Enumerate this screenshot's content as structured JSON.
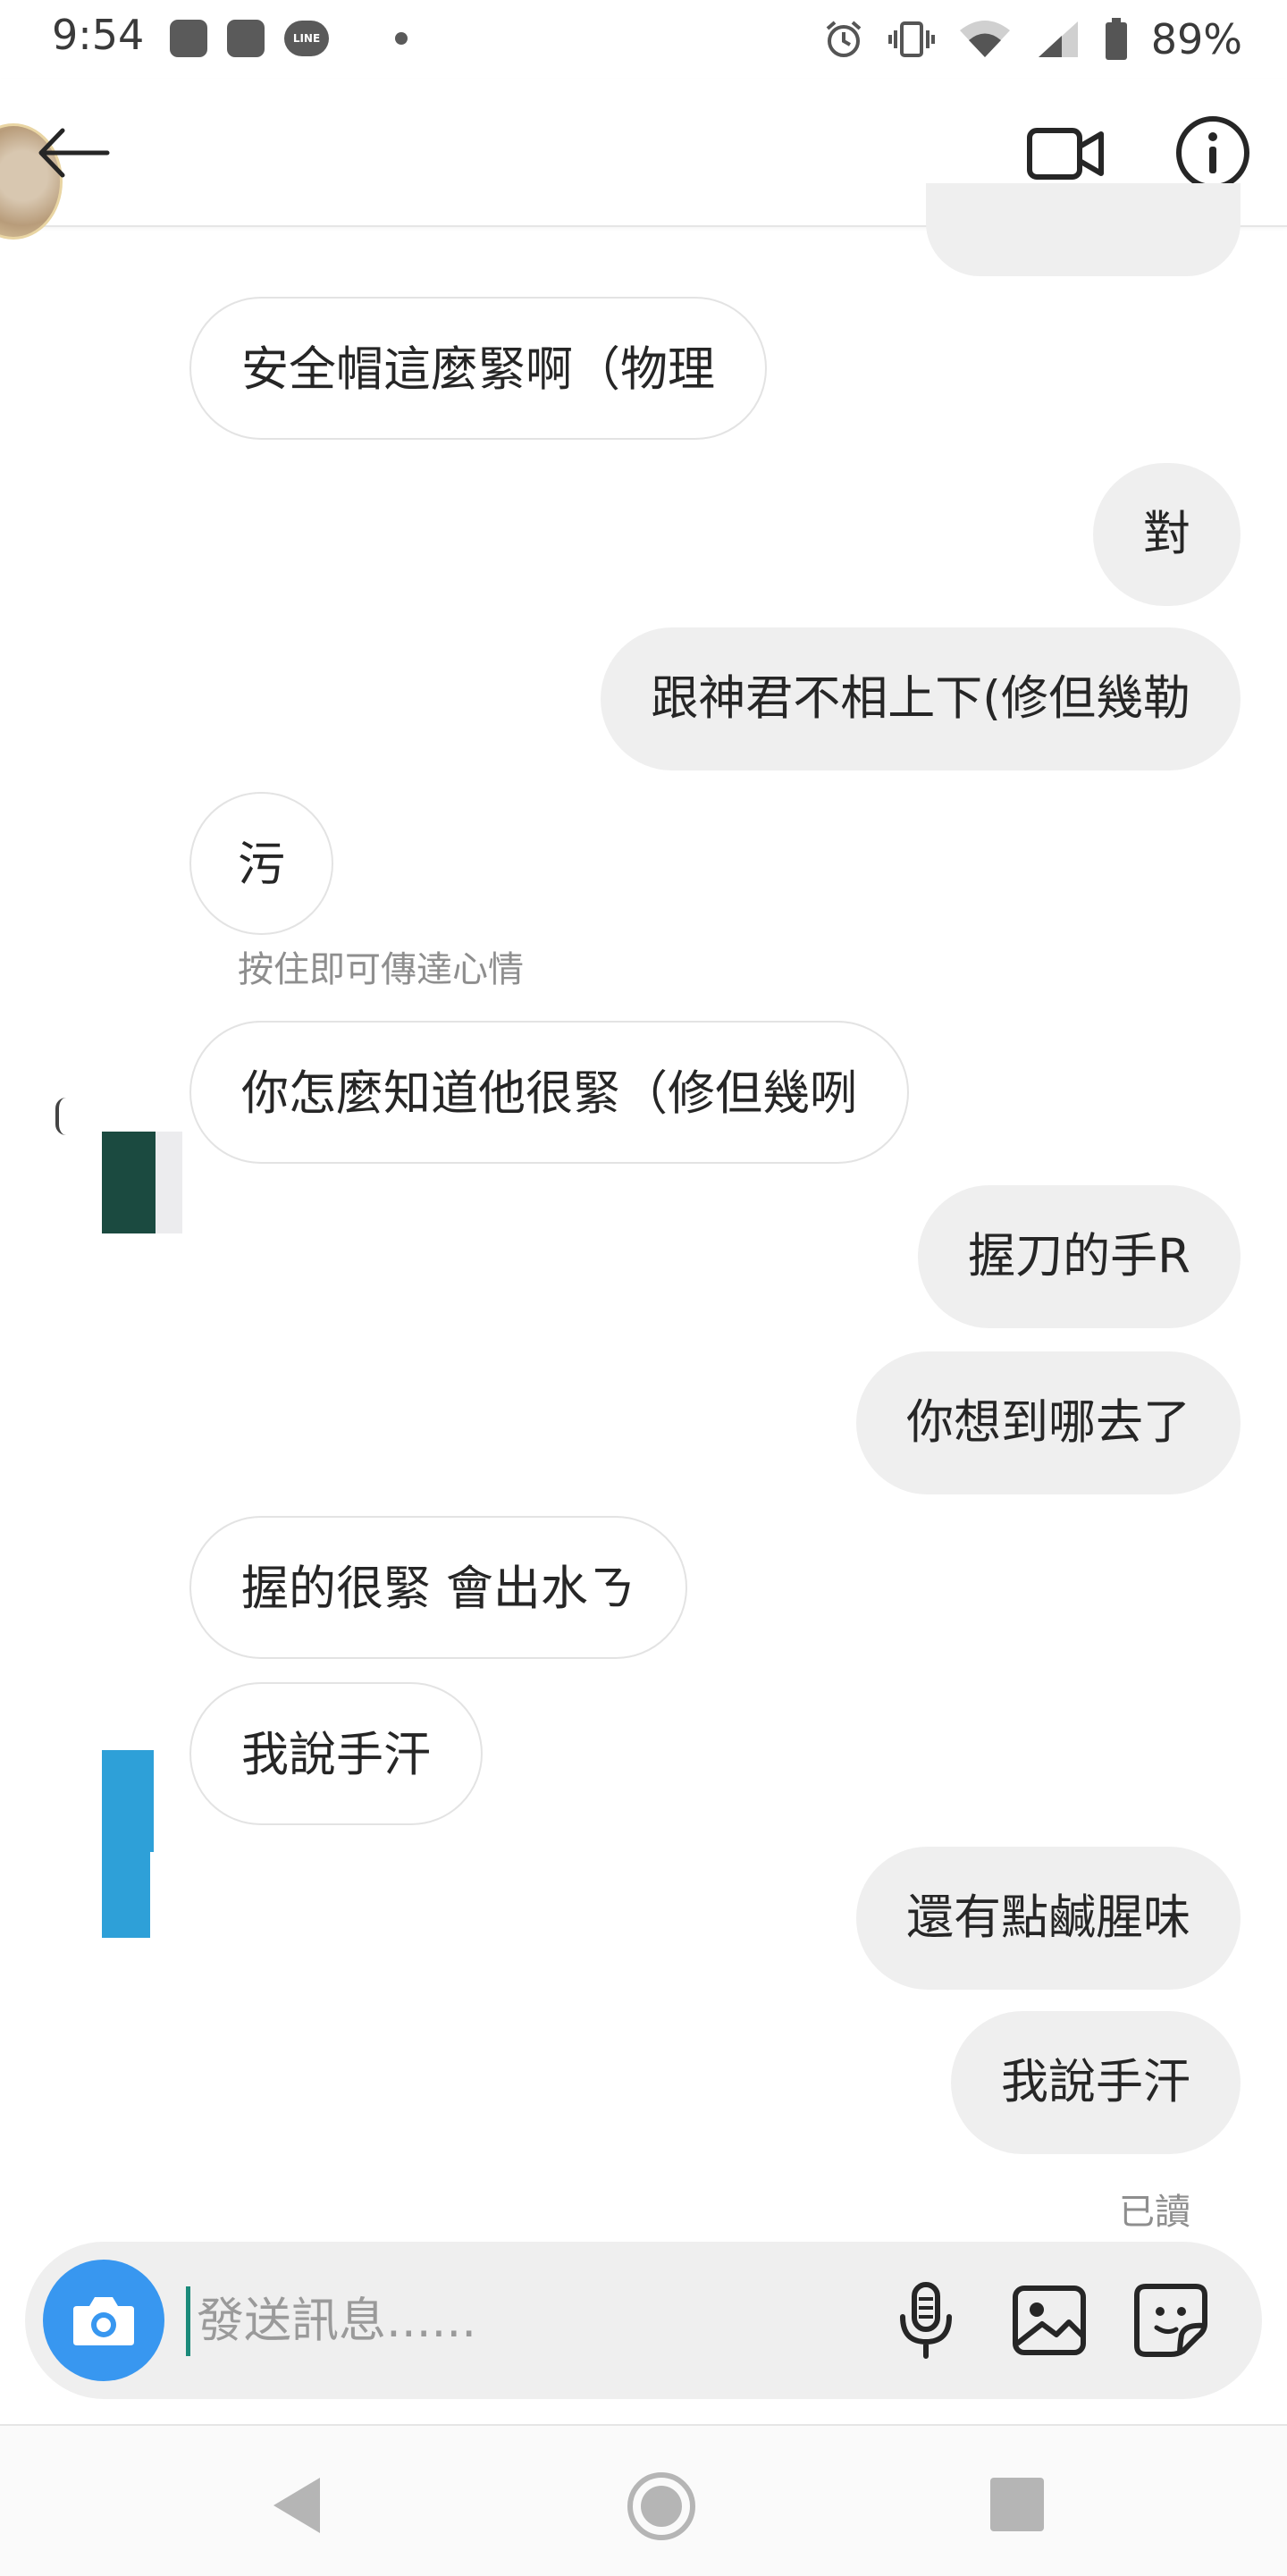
{
  "status_bar": {
    "time": "9:54",
    "battery": "89%",
    "icons": [
      "notification-icon",
      "notification-icon",
      "line-app-icon",
      "dot-icon",
      "alarm-icon",
      "vibrate-icon",
      "wifi-icon",
      "signal-icon",
      "battery-icon"
    ],
    "line_label": "LINE"
  },
  "header": {
    "icons": [
      "back-arrow-icon",
      "video-call-icon",
      "info-icon"
    ]
  },
  "messages": [
    {
      "side": "in",
      "text": "安全帽這麼緊啊（物理"
    },
    {
      "side": "out",
      "text": "對"
    },
    {
      "side": "out",
      "text": "跟神君不相上下(修但幾勒"
    },
    {
      "side": "in",
      "text": "污"
    },
    {
      "side": "in",
      "text": "你怎麼知道他很緊（修但幾咧"
    },
    {
      "side": "out",
      "text": "握刀的手R"
    },
    {
      "side": "out",
      "text": "你想到哪去了"
    },
    {
      "side": "in",
      "text": "握的很緊 會出水ㄋ"
    },
    {
      "side": "in",
      "text": "我說手汗"
    },
    {
      "side": "out",
      "text": "還有點鹹腥味"
    },
    {
      "side": "out",
      "text": "我說手汗"
    }
  ],
  "hint_text": "按住即可傳達心情",
  "seen_text": "已讀",
  "composer": {
    "placeholder": "發送訊息......",
    "icons": [
      "camera-icon",
      "microphone-icon",
      "gallery-icon",
      "sticker-icon"
    ]
  },
  "nav": {
    "icons": [
      "nav-back-icon",
      "nav-home-icon",
      "nav-recents-icon"
    ]
  }
}
